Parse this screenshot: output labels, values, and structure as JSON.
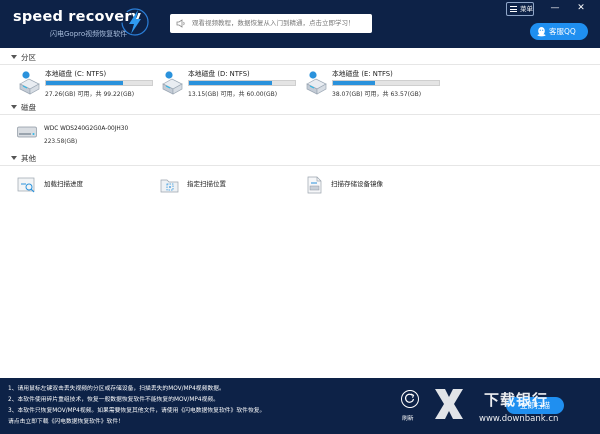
{
  "header": {
    "logo_main": "speed recovery",
    "logo_sub": "闪电Gopro视频恢复软件",
    "notice_text": "观看视频教程，数据恢复从入门到精通，点击立即学习！",
    "menu_label": "菜单",
    "min_glyph": "—",
    "close_glyph": "✕",
    "qq_label": "客服QQ"
  },
  "sections": {
    "partition_title": "分区",
    "disk_title": "磁盘",
    "other_title": "其他"
  },
  "drives": [
    {
      "name": "本地磁盘 (C: NTFS)",
      "usage": "27.26(GB) 可用，共 99.22(GB)",
      "used_fraction": 0.725
    },
    {
      "name": "本地磁盘 (D: NTFS)",
      "usage": "13.15(GB) 可用，共 60.00(GB)",
      "used_fraction": 0.78
    },
    {
      "name": "本地磁盘 (E: NTFS)",
      "usage": "38.07(GB) 可用，共 63.57(GB)",
      "used_fraction": 0.4
    }
  ],
  "disk": {
    "name": "WDC WDS240G2G0A-00JH30",
    "size": "223.58(GB)"
  },
  "others": [
    {
      "label": "加载扫描进度",
      "icon": "load-progress-icon"
    },
    {
      "label": "指定扫描位置",
      "icon": "scan-location-icon"
    },
    {
      "label": "扫描存储设备镜像",
      "icon": "disk-image-icon"
    }
  ],
  "footer": {
    "lines": [
      "1、请用鼠标左键双击丢失视频的分区或存储设备，扫描丢失的MOV/MP4视频数据。",
      "2、本软件使用碎片重组技术，恢复一般数据恢复软件不能恢复的MOV/MP4视频。",
      "3、本软件只恢复MOV/MP4视频。如果需要恢复其他文件，请使用《闪电数据恢复软件》软件恢复。",
      "请点击立即下载《闪电数据恢复软件》软件！"
    ],
    "refresh_label": "刷新",
    "scan_label": "立即扫描"
  },
  "watermark": {
    "text": "下载银行",
    "url": "www.downbank.cn"
  },
  "colors": {
    "header_bg": "#0d2247",
    "accent": "#1f8ff0",
    "bar_fill": "#2a92dc"
  }
}
